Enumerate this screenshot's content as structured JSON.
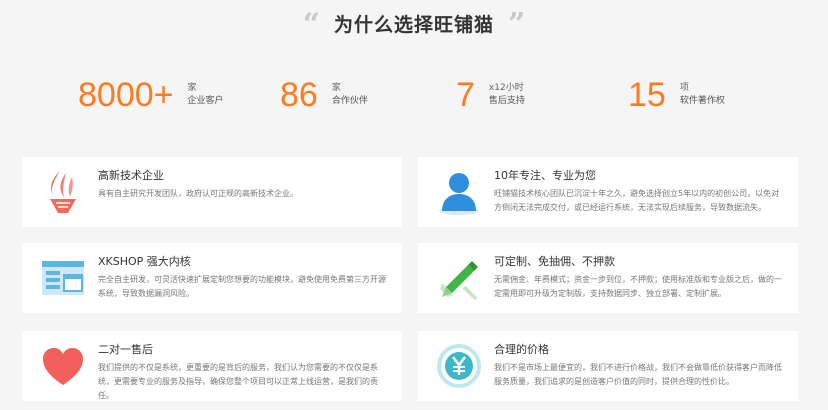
{
  "heading": {
    "quote_open": "“",
    "title": "为什么选择旺铺猫",
    "quote_close": "”"
  },
  "stats": [
    {
      "number": "8000+",
      "unit": "家",
      "label": "企业客户"
    },
    {
      "number": "86",
      "unit": "家",
      "label": "合作伙伴"
    },
    {
      "number": "7",
      "unit": "x12小时",
      "label": "售后支持"
    },
    {
      "number": "15",
      "unit": "项",
      "label": "软件著作权"
    }
  ],
  "features": [
    {
      "icon": "torch-icon",
      "title": "高新技术企业",
      "desc": "具有自主研究开发团队，政府认可正规的高新技术企业。"
    },
    {
      "icon": "person-icon",
      "title": "10年专注、专业为您",
      "desc": "旺铺猫技术核心团队已沉淀十年之久，避免选择创立5年以内的初创公司，以免对方倒闭无法完成交付，或已经运行系统，无法实现后续服务，导致数据流失。"
    },
    {
      "icon": "window-icon",
      "title": "XKSHOP 强大内核",
      "desc": "完全自主研发，可灵活快速扩展定制您想要的功能模块，避免使用免费第三方开源系统，导致数据漏洞风险。"
    },
    {
      "icon": "pencil-ruler-icon",
      "title": "可定制、免抽佣、不押款",
      "desc": "无需佣金、年费模式；资金一步到位，不押款；使用标准版和专业版之后，做的一定需用即可升级为定制版，支持数据同步、独立部署、定制扩展。"
    },
    {
      "icon": "heart-icon",
      "title": "二对一售后",
      "desc": "我们提供的不仅是系统，更重要的是背后的服务，我们认为您需要的不仅仅是系统，更需要专业的服务及指导，确保您整个项目可以正常上线运营，是我们的责任。"
    },
    {
      "icon": "yen-icon",
      "title": "合理的价格",
      "desc": "我们不是市场上最便宜的，我们不进行价格战，我们不会做靠低价获得客户而降低服务质量，我们追求的是创造客户价值的同时，提供合理的性价比。"
    }
  ],
  "colors": {
    "accent": "#ff7b1f",
    "torch": "#f06a5e",
    "person": "#2f8fde",
    "window": "#5fb4e6",
    "pencil": "#43b547",
    "heart": "#f2605c",
    "yen": "#3db8c7"
  }
}
